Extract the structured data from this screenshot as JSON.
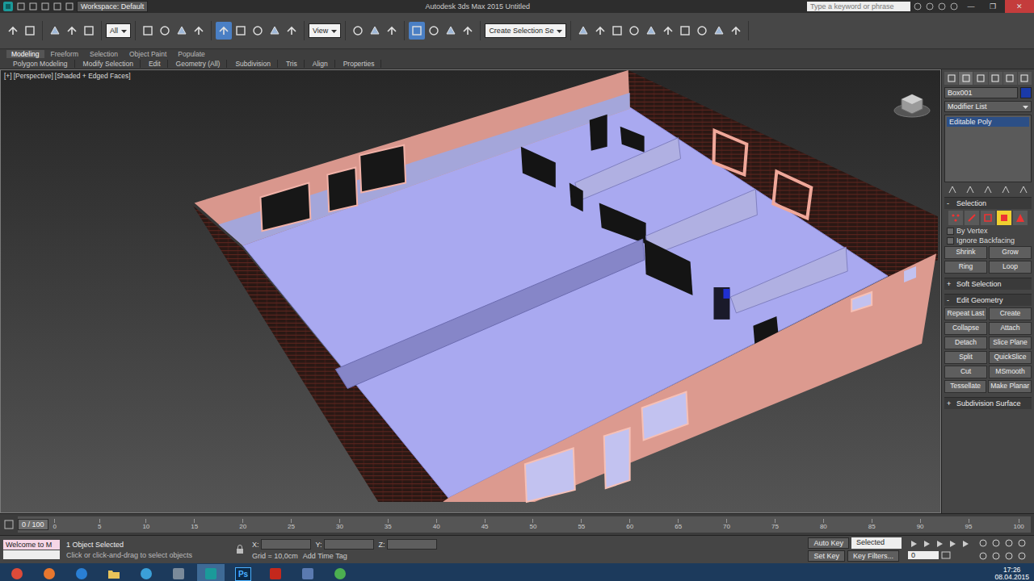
{
  "window": {
    "title": "Autodesk 3ds Max 2015    Untitled",
    "workspace": "Workspace: Default",
    "search": {
      "placeholder": "Type a keyword or phrase"
    },
    "controls": [
      "—",
      "❐",
      "✕"
    ]
  },
  "toolbar": {
    "groups": [
      {
        "kind": "tools",
        "tools": [
          {
            "selected": false
          },
          {
            "selected": false
          }
        ]
      },
      {
        "kind": "tools",
        "tools": [
          {
            "selected": false
          },
          {
            "selected": false
          },
          {
            "selected": false
          }
        ]
      },
      {
        "kind": "field",
        "value": "All"
      },
      {
        "kind": "tools",
        "tools": [
          {
            "selected": false
          },
          {
            "selected": false
          },
          {
            "selected": false
          },
          {
            "selected": false
          }
        ]
      },
      {
        "kind": "tools",
        "tools": [
          {
            "selected": true
          },
          {
            "selected": false
          },
          {
            "selected": false
          },
          {
            "selected": false
          },
          {
            "selected": false
          }
        ]
      },
      {
        "kind": "field",
        "value": "View"
      },
      {
        "kind": "tools",
        "tools": [
          {
            "selected": false
          },
          {
            "selected": false
          },
          {
            "selected": false
          }
        ]
      },
      {
        "kind": "tools",
        "tools": [
          {
            "selected": true
          },
          {
            "selected": false
          },
          {
            "selected": false
          },
          {
            "selected": false
          }
        ]
      },
      {
        "kind": "field",
        "value": "Create Selection Se"
      },
      {
        "kind": "tools",
        "tools": [
          {
            "selected": false
          },
          {
            "selected": false
          },
          {
            "selected": false
          },
          {
            "selected": false
          },
          {
            "selected": false
          },
          {
            "selected": false
          },
          {
            "selected": false
          },
          {
            "selected": false
          },
          {
            "selected": false
          },
          {
            "selected": false
          }
        ]
      }
    ]
  },
  "ribbon": {
    "tabs": [
      {
        "label": "Modeling",
        "selected": true
      },
      {
        "label": "Freeform",
        "selected": false
      },
      {
        "label": "Selection",
        "selected": false
      },
      {
        "label": "Object Paint",
        "selected": false
      },
      {
        "label": "Populate",
        "selected": false
      }
    ],
    "panels": [
      "Polygon Modeling",
      "Modify Selection",
      "Edit",
      "Geometry (All)",
      "Subdivision",
      "Tris",
      "Align",
      "Properties"
    ]
  },
  "viewport": {
    "labels": [
      "[+]",
      "[Perspective]",
      "[Shaded + Edged Faces]"
    ]
  },
  "command_panel": {
    "tabs": [
      {
        "selected": false
      },
      {
        "selected": true
      },
      {
        "selected": false
      },
      {
        "selected": false
      },
      {
        "selected": false
      },
      {
        "selected": false
      }
    ],
    "object_name": "Box001",
    "modifier_list": "Modifier List",
    "stack": [
      {
        "label": "Editable Poly",
        "selected": true
      }
    ],
    "rollouts": [
      {
        "kind": "selection",
        "sign": "-",
        "title": "Selection",
        "subobjects": [
          {
            "kind": "vertex",
            "selected": false
          },
          {
            "kind": "edge",
            "selected": false
          },
          {
            "kind": "border",
            "selected": false
          },
          {
            "kind": "polygon",
            "selected": true
          },
          {
            "kind": "element",
            "selected": false
          }
        ],
        "options": [
          {
            "label": "By Vertex",
            "checked": false
          },
          {
            "label": "Ignore Backfacing",
            "checked": false
          }
        ],
        "buttons": [
          "Shrink",
          "Grow",
          "Ring",
          "Loop"
        ]
      },
      {
        "kind": "collapsed",
        "sign": "+",
        "title": "Soft Selection"
      },
      {
        "kind": "buttons",
        "sign": "-",
        "title": "Edit Geometry",
        "buttons": [
          "Repeat Last",
          "Create",
          "Collapse",
          "Attach",
          "Detach",
          "Slice Plane",
          "Split",
          "QuickSlice",
          "Cut",
          "MSmooth",
          "Tessellate",
          "Make Planar"
        ]
      },
      {
        "kind": "collapsed",
        "sign": "+",
        "title": "Subdivision Surface"
      }
    ]
  },
  "timeline": {
    "slider": "0 / 100",
    "ticks": [
      "0",
      "5",
      "10",
      "15",
      "20",
      "25",
      "30",
      "35",
      "40",
      "45",
      "50",
      "55",
      "60",
      "65",
      "70",
      "75",
      "80",
      "85",
      "90",
      "95",
      "100"
    ]
  },
  "status": {
    "maxscript": "Welcome to M",
    "message": "1 Object Selected",
    "prompt": "Click or click-and-drag to select objects",
    "coords": [
      "X:",
      "Y:",
      "Z:"
    ],
    "grid": "Grid = 10,0cm",
    "add_time_tag": "Add Time Tag",
    "auto_key": "Auto Key",
    "auto_key_on": false,
    "key_mode": "Selected",
    "set_key": "Set Key",
    "key_filters": "Key Filters...",
    "frame": "0"
  },
  "taskbar": {
    "apps": [
      {
        "kind": "globe",
        "color": "#dd4b39",
        "active": false,
        "label": ""
      },
      {
        "kind": "globe",
        "color": "#e8772e",
        "active": false,
        "label": ""
      },
      {
        "kind": "globe",
        "color": "#2a7fd4",
        "active": false,
        "label": ""
      },
      {
        "kind": "folder",
        "color": "#e8c35a",
        "active": false,
        "label": ""
      },
      {
        "kind": "globe",
        "color": "#3ba0d8",
        "active": false,
        "label": ""
      },
      {
        "kind": "box",
        "color": "#7a8a9a",
        "active": false,
        "label": ""
      },
      {
        "kind": "box",
        "color": "#1b9a9a",
        "active": true,
        "label": ""
      },
      {
        "kind": "label",
        "color": "#0a2a4a",
        "active": false,
        "label": "Ps"
      },
      {
        "kind": "box",
        "color": "#c4281c",
        "active": false,
        "label": ""
      },
      {
        "kind": "box",
        "color": "#5a7ab0",
        "active": false,
        "label": ""
      },
      {
        "kind": "globe",
        "color": "#4caf50",
        "active": false,
        "label": ""
      }
    ],
    "time": "17:26",
    "date": "08.04.2015"
  }
}
